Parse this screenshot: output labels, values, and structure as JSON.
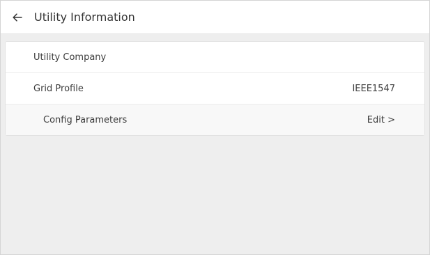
{
  "header": {
    "back_icon": "arrow-left-icon",
    "title": "Utility Information"
  },
  "rows": {
    "utility_company": {
      "label": "Utility Company",
      "value": ""
    },
    "grid_profile": {
      "label": "Grid Profile",
      "value": "IEEE1547"
    },
    "config_parameters": {
      "label": "Config Parameters",
      "action": "Edit >"
    }
  },
  "colors": {
    "background": "#eeeeee",
    "card": "#ffffff",
    "text": "#333333"
  }
}
